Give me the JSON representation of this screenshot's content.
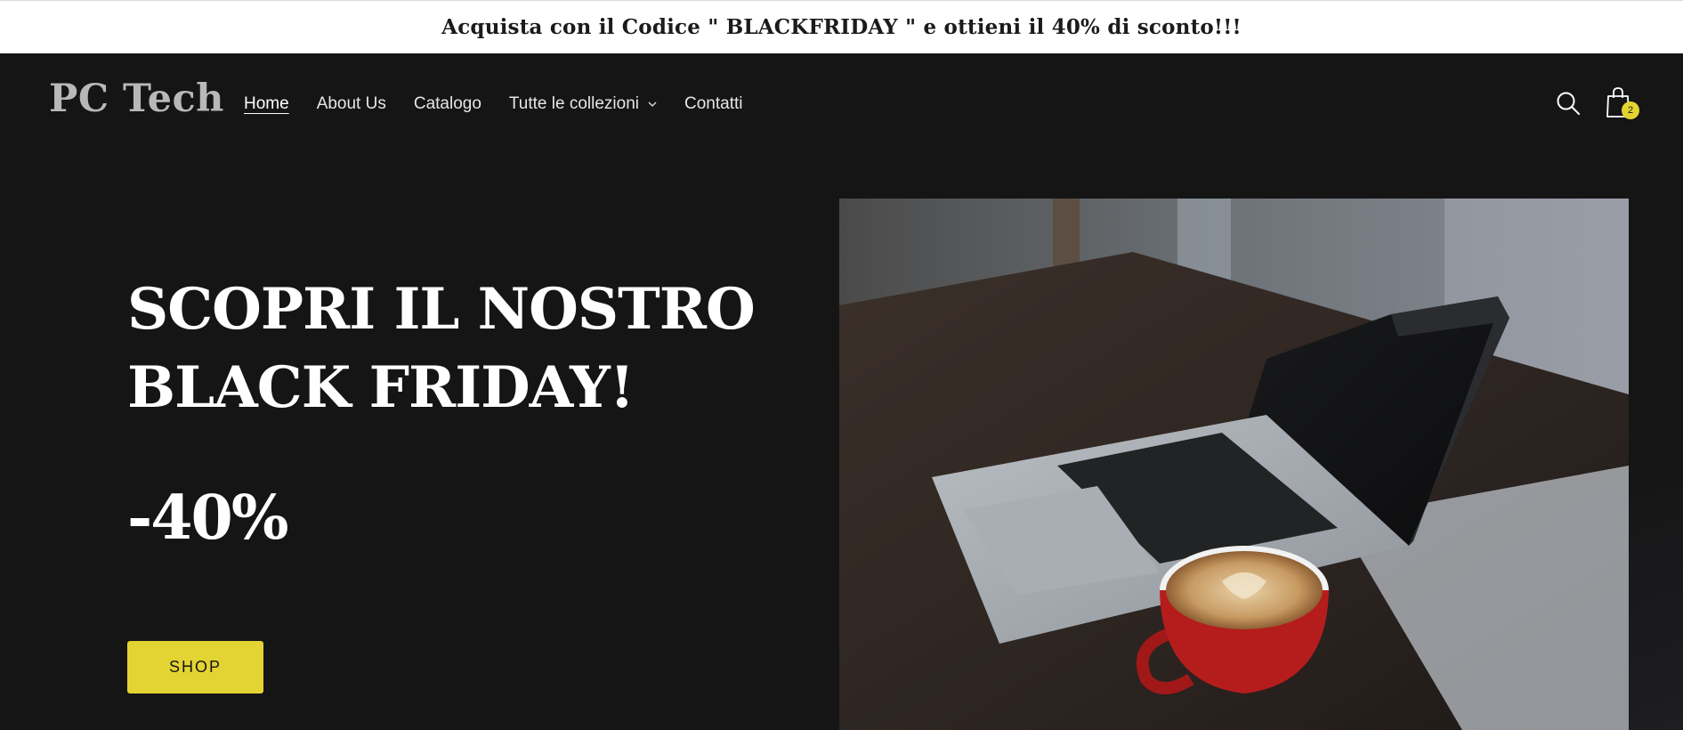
{
  "announcement": {
    "text": "Acquista con il Codice \" BLACKFRIDAY \" e ottieni il 40% di sconto!!!"
  },
  "header": {
    "logo": "PC Tech",
    "nav": [
      {
        "label": "Home",
        "active": true
      },
      {
        "label": "About Us"
      },
      {
        "label": "Catalogo"
      },
      {
        "label": "Tutte le collezioni",
        "dropdown": true
      },
      {
        "label": "Contatti"
      }
    ],
    "icons": {
      "search": "search-icon",
      "cart": "shopping-bag-icon"
    },
    "cart_count": "2"
  },
  "hero": {
    "title_line1": "SCOPRI IL NOSTRO",
    "title_line2": "BLACK FRIDAY!",
    "discount": "-40%",
    "button_label": "SHOP",
    "image": "laptop-and-coffee-cup-photo"
  },
  "colors": {
    "background": "#151515",
    "accent": "#e4d433",
    "announcement_bg": "#ffffff"
  }
}
